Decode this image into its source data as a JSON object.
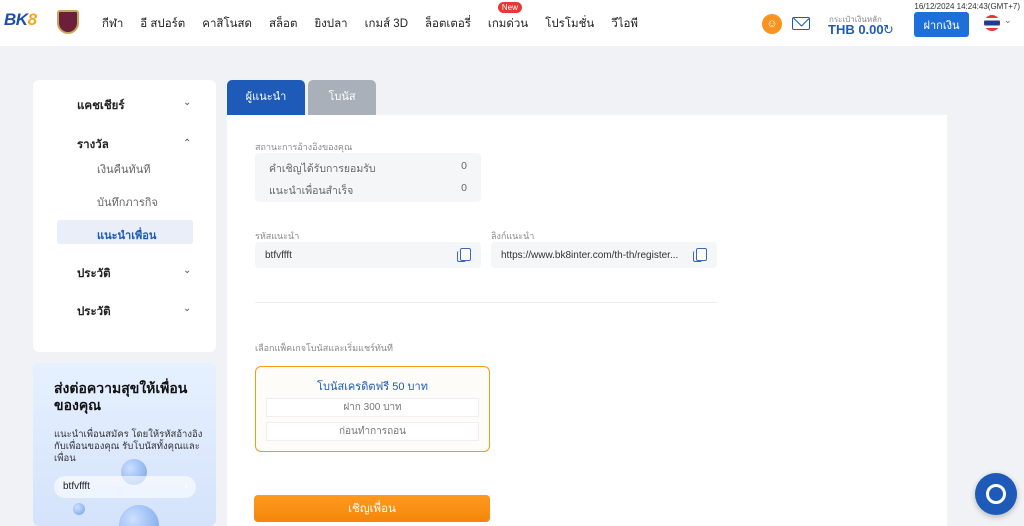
{
  "header": {
    "logo_main": "BK",
    "logo_accent": "8",
    "nav": [
      {
        "label": "กีฬา"
      },
      {
        "label": "อี สปอร์ต"
      },
      {
        "label": "คาสิโนสด"
      },
      {
        "label": "สล็อต"
      },
      {
        "label": "ยิงปลา"
      },
      {
        "label": "เกมส์ 3D"
      },
      {
        "label": "ล็อตเตอรี่"
      },
      {
        "label": "เกมด่วน",
        "badge": "New"
      },
      {
        "label": "โปรโมชั่น"
      },
      {
        "label": "วีไอพี"
      }
    ],
    "balance_label": "กระเป๋าเงินหลัก",
    "balance_value": "THB 0.00",
    "deposit_label": "ฝากเงิน",
    "datetime": "16/12/2024 14:24:43(GMT+7)"
  },
  "sidebar": {
    "cashier": "แคชเชียร์",
    "rewards": "รางวัล",
    "rewards_items": [
      "เงินคืนทันที",
      "บันทึกภารกิจ"
    ],
    "active_item": "แนะนำเพื่อน",
    "history1": "ประวัติ",
    "history2": "ประวัติ"
  },
  "promo": {
    "title": "ส่งต่อความสุขให้เพื่อนของคุณ",
    "desc": "แนะนำเพื่อนสมัคร โดยให้รหัสอ้างอิงกับเพื่อนของคุณ รับโบนัสทั้งคุณและเพื่อน",
    "code": "btfvffft"
  },
  "tabs": {
    "active": "ผู้แนะนำ",
    "inactive": "โบนัส"
  },
  "referral": {
    "status_label": "สถานะการอ้างอิงของคุณ",
    "accepted_label": "คำเชิญได้รับการยอมรับ",
    "accepted_value": "0",
    "success_label": "แนะนำเพื่อนสำเร็จ",
    "success_value": "0",
    "code_label": "รหัสแนะนำ",
    "code_value": "btfvffft",
    "link_label": "ลิงก์แนะนำ",
    "link_value": "https://www.bk8inter.com/th-th/register...",
    "package_label": "เลือกแพ็คเกจโบนัสและเริ่มแชร์ทันที",
    "package_title": "โบนัสเครดิตฟรี 50 บาท",
    "package_line1": "ฝาก 300 บาท",
    "package_line2": "ก่อนทำการถอน",
    "invite_label": "เชิญเพื่อน"
  },
  "colors": {
    "primary": "#1e5bb8",
    "accent": "#f5860a",
    "background": "#f1f2f5"
  }
}
